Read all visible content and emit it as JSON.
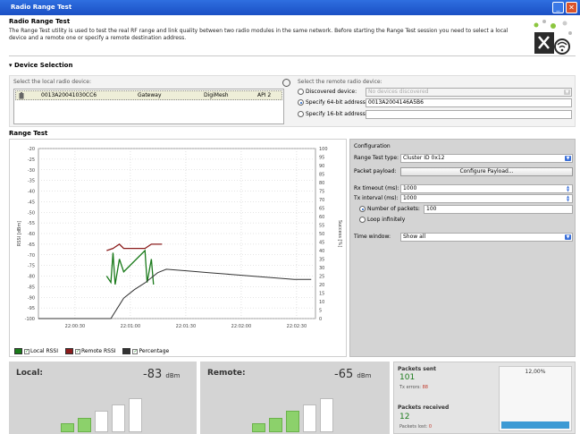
{
  "window": {
    "title": "Radio Range Test",
    "min_icon": "_",
    "close_icon": "✕"
  },
  "header": {
    "title": "Radio Range Test",
    "description": "The Range Test utility is used to test the real RF range and link quality between two radio modules in the same network. Before starting the Range Test session you need to select a local device and a remote one or specify a remote destination address."
  },
  "device_selection": {
    "title": "Device Selection",
    "local_caption": "Select the local radio device:",
    "local_device": {
      "address": "0013A20041030CC6",
      "role": "Gateway",
      "protocol": "DigiMesh",
      "api": "API 2"
    },
    "remote_caption": "Select the remote radio device:",
    "remote_options": [
      {
        "label": "Discovered device:",
        "value": "No devices discovered",
        "selected": false
      },
      {
        "label": "Specify 64-bit address:",
        "value": "0013A2004146A5B6",
        "selected": true
      },
      {
        "label": "Specify 16-bit address:",
        "value": "",
        "selected": false
      }
    ]
  },
  "range_test": {
    "title": "Range Test"
  },
  "chart_data": {
    "type": "line",
    "ylabel_left": "RSSI [dBm]",
    "ylabel_right": "Success [%]",
    "y_left_ticks": [
      -20,
      -25,
      -30,
      -35,
      -40,
      -45,
      -50,
      -55,
      -60,
      -65,
      -70,
      -75,
      -80,
      -85,
      -90,
      -95,
      -100
    ],
    "y_right_ticks": [
      100,
      95,
      90,
      85,
      80,
      75,
      70,
      65,
      60,
      55,
      50,
      45,
      40,
      35,
      30,
      25,
      20,
      15,
      10,
      5,
      0
    ],
    "x_ticks": [
      "22:00:30",
      "22:01:00",
      "22:01:30",
      "22:02:00",
      "22:02:30"
    ],
    "ylim_left": [
      -100,
      -20
    ],
    "ylim_right": [
      0,
      100
    ],
    "xlim_seconds": [
      0,
      130
    ],
    "grid": true,
    "series": [
      {
        "name": "Local RSSI",
        "color": "#1a7a1a",
        "axis": "left",
        "x": [
          32,
          34,
          35,
          36,
          38,
          40,
          45,
          50,
          51,
          53,
          54
        ],
        "y": [
          -80,
          -83,
          -69,
          -84,
          -72,
          -78,
          -73,
          -68,
          -83,
          -72,
          -84
        ]
      },
      {
        "name": "Remote RSSI",
        "color": "#8b1c1c",
        "axis": "left",
        "x": [
          32,
          35,
          38,
          40,
          50,
          53,
          58
        ],
        "y": [
          -68,
          -67,
          -65,
          -67,
          -67,
          -65,
          -65
        ]
      },
      {
        "name": "Percentage",
        "color": "#333333",
        "axis": "right",
        "x": [
          0,
          31,
          34,
          35,
          38,
          40,
          45,
          50,
          53,
          56,
          60,
          70,
          80,
          90,
          100,
          110,
          120,
          128
        ],
        "y": [
          0,
          0,
          0,
          2,
          8,
          12,
          17,
          21,
          24,
          27,
          29,
          28,
          27,
          26,
          25,
          24,
          23,
          23
        ]
      }
    ],
    "legend_position": "bottom-left"
  },
  "legend": [
    {
      "label": "Local RSSI",
      "color": "#1a7a1a"
    },
    {
      "label": "Remote RSSI",
      "color": "#8b1c1c"
    },
    {
      "label": "Percentage",
      "color": "#333333"
    }
  ],
  "configuration": {
    "title": "Configuration",
    "test_type_label": "Range Test type:",
    "test_type_value": "Cluster ID 0x12",
    "payload_label": "Packet payload:",
    "payload_button": "Configure Payload...",
    "rx_timeout_label": "Rx timeout (ms):",
    "rx_timeout_value": "1000",
    "tx_interval_label": "Tx interval (ms):",
    "tx_interval_value": "1000",
    "num_packets_label": "Number of packets:",
    "num_packets_value": "100",
    "loop_label": "Loop infinitely",
    "time_window_label": "Time window:",
    "time_window_value": "Show all"
  },
  "local_rssi": {
    "label": "Local:",
    "value": "-83",
    "unit": "dBm",
    "bars_on": 2,
    "bars_total": 5
  },
  "remote_rssi": {
    "label": "Remote:",
    "value": "-65",
    "unit": "dBm",
    "bars_on": 3,
    "bars_total": 5
  },
  "stats": {
    "sent_label": "Packets sent",
    "sent_value": "101",
    "tx_errors_label": "Tx errors:",
    "tx_errors_value": "88",
    "received_label": "Packets received",
    "received_value": "12",
    "lost_label": "Packets lost:",
    "lost_value": "0",
    "percentage_label": "12,00%",
    "percentage": 0.12
  }
}
